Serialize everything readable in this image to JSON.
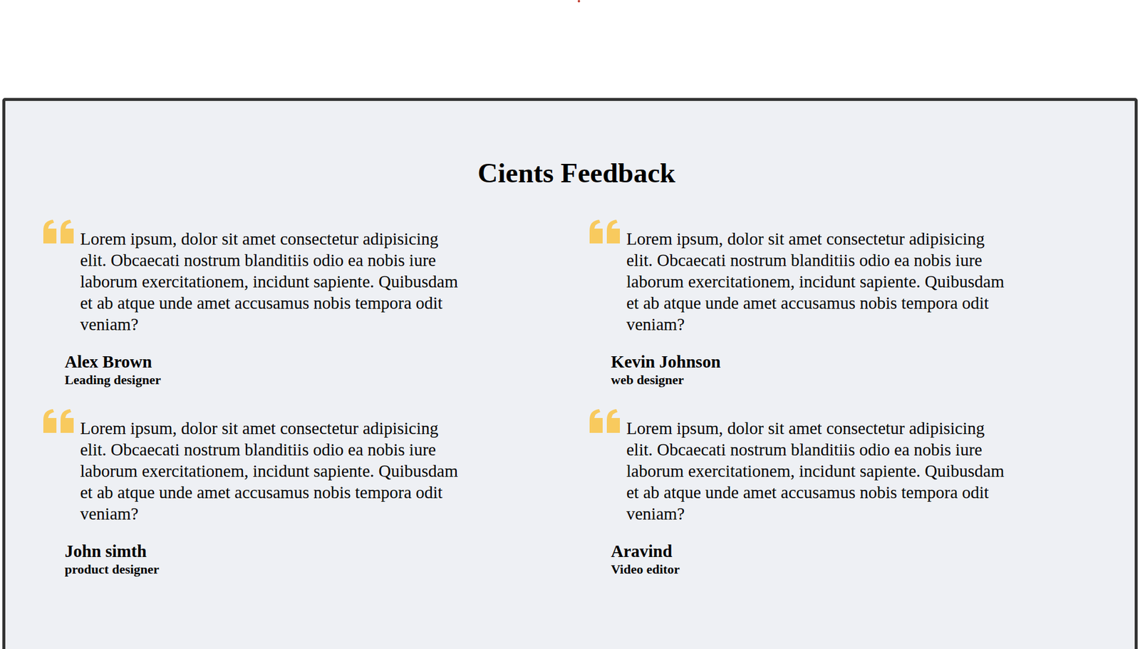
{
  "section": {
    "title": "Cients Feedback"
  },
  "testimonials": [
    {
      "quote": "Lorem ipsum, dolor sit amet consectetur adipisicing elit. Obcaecati nostrum blanditiis odio ea nobis iure laborum exercitationem, incidunt sapiente. Quibusdam et ab atque unde amet accusamus nobis tempora odit veniam?",
      "name": "Alex Brown",
      "role": "Leading designer"
    },
    {
      "quote": "Lorem ipsum, dolor sit amet consectetur adipisicing elit. Obcaecati nostrum blanditiis odio ea nobis iure laborum exercitationem, incidunt sapiente. Quibusdam et ab atque unde amet accusamus nobis tempora odit veniam?",
      "name": "Kevin Johnson",
      "role": "web designer"
    },
    {
      "quote": "Lorem ipsum, dolor sit amet consectetur adipisicing elit. Obcaecati nostrum blanditiis odio ea nobis iure laborum exercitationem, incidunt sapiente. Quibusdam et ab atque unde amet accusamus nobis tempora odit veniam?",
      "name": "John simth",
      "role": "product designer"
    },
    {
      "quote": "Lorem ipsum, dolor sit amet consectetur adipisicing elit. Obcaecati nostrum blanditiis odio ea nobis iure laborum exercitationem, incidunt sapiente. Quibusdam et ab atque unde amet accusamus nobis tempora odit veniam?",
      "name": "Aravind",
      "role": "Video editor"
    }
  ]
}
